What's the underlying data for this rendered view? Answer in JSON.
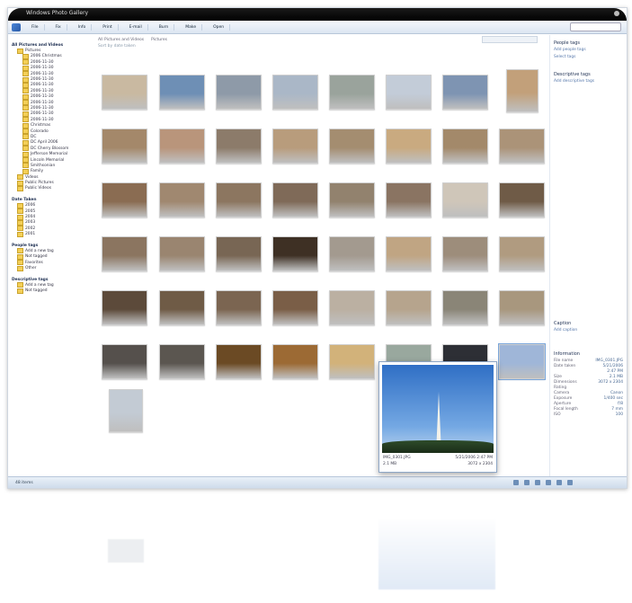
{
  "window": {
    "title": "Windows Photo Gallery"
  },
  "menu": {
    "items": [
      "File",
      "Fix",
      "Info",
      "Print",
      "E-mail",
      "Burn",
      "Make",
      "Open"
    ],
    "search_placeholder": ""
  },
  "breadcrumb": {
    "items": [
      "All Pictures and Videos",
      "Pictures"
    ]
  },
  "subbar": {
    "text": "Sort by date taken"
  },
  "sidebar": {
    "header": "All Pictures and Videos",
    "folders": [
      "Pictures",
      "2006 Christmas",
      "2006-11-30",
      "2006-11-30",
      "2006-11-30",
      "2006-11-30",
      "2006-11-30",
      "2006-11-30",
      "2006-11-30",
      "2006-11-30",
      "2006-11-30",
      "2006-11-30",
      "2006-11-30",
      "Christmas",
      "Colorado",
      "DC",
      "DC April 2006",
      "DC Cherry Blossom",
      "Jefferson Memorial",
      "Lincoln Memorial",
      "Smithsonian",
      "Family",
      "Videos",
      "Public Pictures",
      "Public Videos"
    ],
    "date_header": "Date Taken",
    "dates": [
      "2006",
      "2005",
      "2004",
      "2003",
      "2002",
      "2001"
    ],
    "tags_header": "People tags",
    "tags": [
      "Add a new tag",
      "Not tagged",
      "Favorites",
      "Other"
    ],
    "tags2_header": "Descriptive tags",
    "tags2": [
      "Add a new tag",
      "Not tagged"
    ]
  },
  "rightpane": {
    "people_header": "People tags",
    "people_links": [
      "Add people tags",
      "Select tags"
    ],
    "desc_header": "Descriptive tags",
    "desc_links": [
      "Add descriptive tags"
    ],
    "caption_header": "Caption",
    "caption_link": "Add caption",
    "info_header": "Information",
    "info_rows": [
      [
        "File name",
        "IMG_0301.JPG"
      ],
      [
        "Date taken",
        "5/21/2006"
      ],
      [
        "",
        "2:47 PM"
      ],
      [
        "Size",
        "2.1 MB"
      ],
      [
        "Dimensions",
        "3072 x 2304"
      ],
      [
        "Rating",
        ""
      ],
      [
        "Camera",
        "Canon"
      ],
      [
        "Exposure",
        "1/400 sec"
      ],
      [
        "Aperture",
        "f/8"
      ],
      [
        "Focal length",
        "7 mm"
      ],
      [
        "ISO",
        "100"
      ]
    ]
  },
  "popup": {
    "filename": "IMG_0301.JPG",
    "date": "5/21/2006 2:47 PM",
    "size": "2.1 MB",
    "dims": "3072 x 2304"
  },
  "status": {
    "text": "48 items"
  },
  "thumb_colors": [
    [
      "#c9b9a1",
      "#6e8fb5",
      "#8e9aa8",
      "#aab7c7",
      "#9aa39c",
      "#c3ccd8",
      "#7e94b2",
      "#c2a07a"
    ],
    [
      "#a4886a",
      "#b9957b",
      "#8c7b6a",
      "#b89c7c",
      "#a48d70",
      "#c9aa80",
      "#a3896a",
      "#ab9378"
    ],
    [
      "#8a6c52",
      "#a08870",
      "#8c7660",
      "#7f6a58",
      "#92826e",
      "#8a7462",
      "#cfc6b9",
      "#6f5b47"
    ],
    [
      "#8b7560",
      "#9a8570",
      "#786654",
      "#3e3024",
      "#a39a8f",
      "#c0a583",
      "#9d8d7b",
      "#b09b80"
    ],
    [
      "#5c4a3a",
      "#6f5b46",
      "#7b6551",
      "#7a5e47",
      "#bbb0a2",
      "#b6a48d",
      "#8a8577",
      "#a8977e"
    ],
    [
      "#55504c",
      "#5b5650",
      "#6b4a24",
      "#9c6a34",
      "#d2b27a",
      "#99a89e",
      "#2d2f35",
      "#9fb6d8"
    ],
    [
      "#c3cbd4"
    ]
  ]
}
